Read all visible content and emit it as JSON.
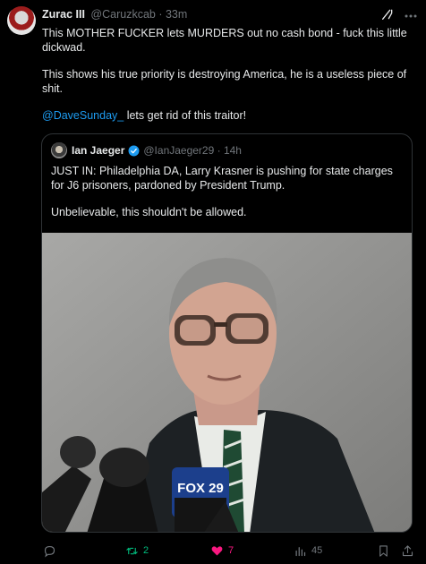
{
  "post": {
    "author": {
      "name": "Zurac III",
      "handle": "@Caruzkcab",
      "time": "33m"
    },
    "lines": [
      "This MOTHER FUCKER lets MURDERS out no cash bond - fuck this little dickwad.",
      "This shows his true priority is destroying America, he is a useless piece of shit."
    ],
    "mention": "@DaveSunday_",
    "mention_text": " lets get rid of this traitor!"
  },
  "quote": {
    "author": {
      "name": "Ian Jaeger",
      "handle": "@IanJaeger29",
      "time": "14h"
    },
    "lines": [
      "JUST IN: Philadelphia DA, Larry Krasner is pushing for state charges for J6 prisoners, pardoned by President Trump.",
      "Unbelievable, this shouldn't be allowed."
    ],
    "photo": {
      "mic_logo": "FOX 29"
    }
  },
  "actions": {
    "reply_count": "",
    "retweet_count": "2",
    "like_count": "7",
    "views_count": "45"
  },
  "colors": {
    "accent": "#1d9bf0",
    "retweet": "#00ba7c",
    "like": "#f91880",
    "muted": "#71767b"
  }
}
